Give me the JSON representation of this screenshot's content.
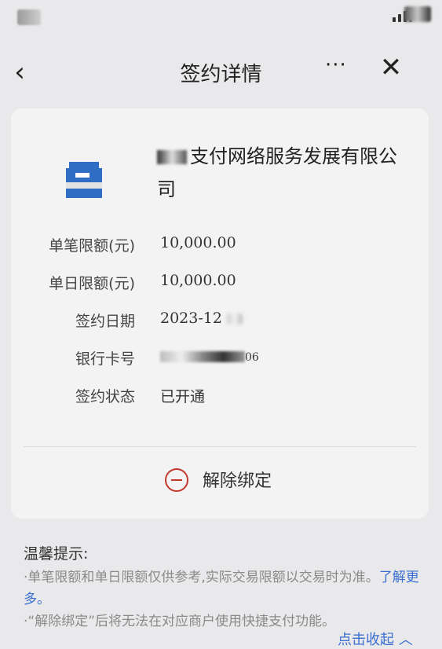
{
  "nav": {
    "title": "签约详情",
    "more": "···",
    "close": "✕",
    "back": "‹"
  },
  "merchant": {
    "name_suffix": "支付网络服务发展有限公司"
  },
  "details": [
    {
      "label": "单笔限额(元)",
      "value": "10,000.00"
    },
    {
      "label": "单日限额(元)",
      "value": "10,000.00"
    },
    {
      "label": "签约日期",
      "value": "2023-12"
    },
    {
      "label": "银行卡号",
      "value": "06"
    },
    {
      "label": "签约状态",
      "value": "已开通"
    }
  ],
  "unbind": {
    "label": "解除绑定"
  },
  "tips": {
    "title": "温馨提示:",
    "items": [
      {
        "text": "·单笔限额和单日限额仅供参考,实际交易限额以交易时为准。",
        "link": "了解更多。"
      },
      {
        "text": "·“解除绑定”后将无法在对应商户使用快捷支付功能。"
      }
    ],
    "collapse": "点击收起 ︿"
  },
  "colors": {
    "background": "#e9e9eb",
    "card": "#f3f3f4",
    "link": "#3a6fd1",
    "danger": "#c0392b",
    "logo_blue": "#2f6ec4"
  }
}
